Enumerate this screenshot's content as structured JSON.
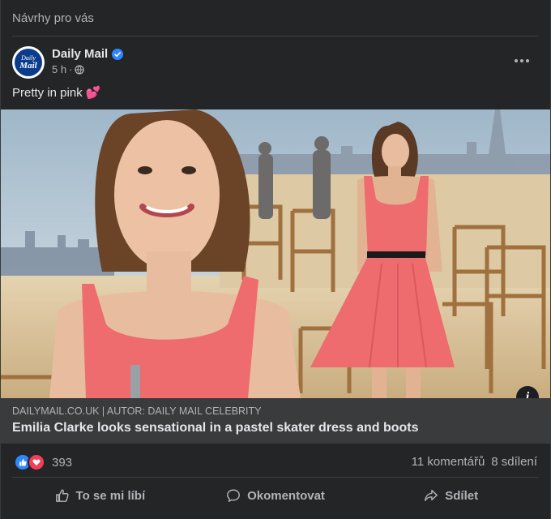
{
  "section_label": "Návrhy pro vás",
  "post": {
    "author": "Daily Mail",
    "avatar_text_top": "Daily",
    "avatar_text_bottom": "Mail",
    "time": "5 h",
    "separator": "·",
    "text": "Pretty in pink 💕"
  },
  "link": {
    "domain": "DAILYMAIL.CO.UK | AUTOR: DAILY MAIL CELEBRITY",
    "headline": "Emilia Clarke looks sensational in a pastel skater dress and boots",
    "info_glyph": "i"
  },
  "stats": {
    "reactions": "393",
    "comments": "11 komentářů",
    "shares": "8 sdílení"
  },
  "actions": {
    "like": "To se mi líbí",
    "comment": "Okomentovat",
    "share": "Sdílet"
  },
  "colors": {
    "background": "#242526",
    "link_box": "#3a3b3c",
    "like_blue": "#2d88ff",
    "love_red": "#f33e58",
    "dress_pink": "#ee6b6e"
  },
  "icons": [
    "verified-badge-icon",
    "globe-icon",
    "more-options-icon",
    "info-icon",
    "like-reaction-icon",
    "love-reaction-icon",
    "thumbs-up-icon",
    "comment-icon",
    "share-icon"
  ]
}
